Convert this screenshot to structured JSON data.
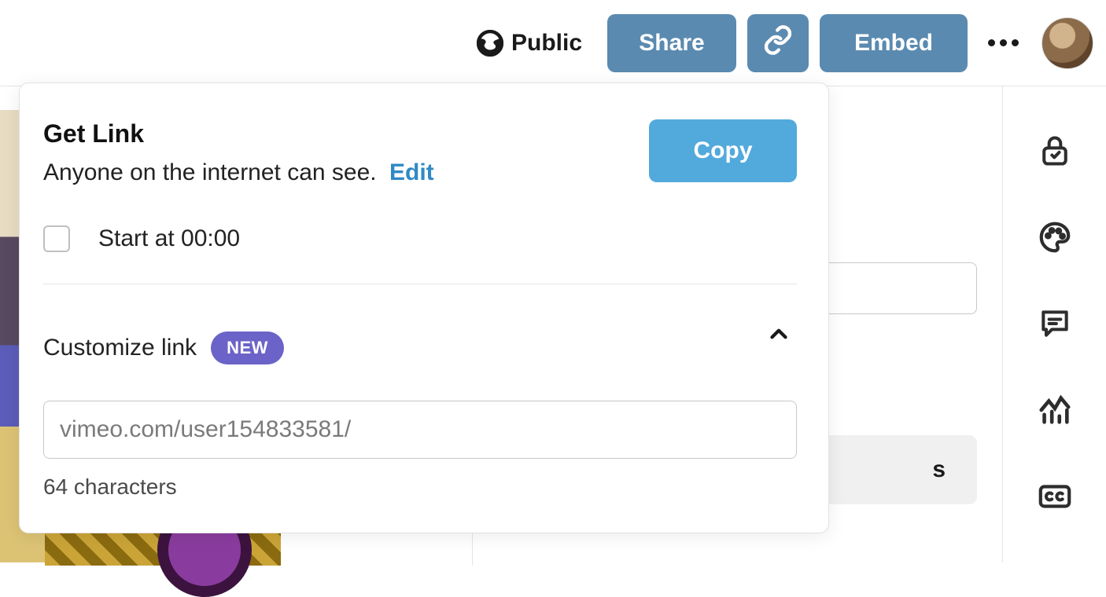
{
  "topbar": {
    "privacy_label": "Public",
    "share_label": "Share",
    "embed_label": "Embed"
  },
  "panel": {
    "title": "Get Link",
    "subtitle_text": "Anyone on the internet can see.",
    "subtitle_action": "Edit",
    "copy_label": "Copy",
    "startat_label": "Start at 00:00",
    "customize_label": "Customize link",
    "new_badge": "NEW",
    "url_placeholder": "vimeo.com/user154833581/",
    "charcount": "64 characters"
  },
  "bg": {
    "pill_tail": "s"
  }
}
